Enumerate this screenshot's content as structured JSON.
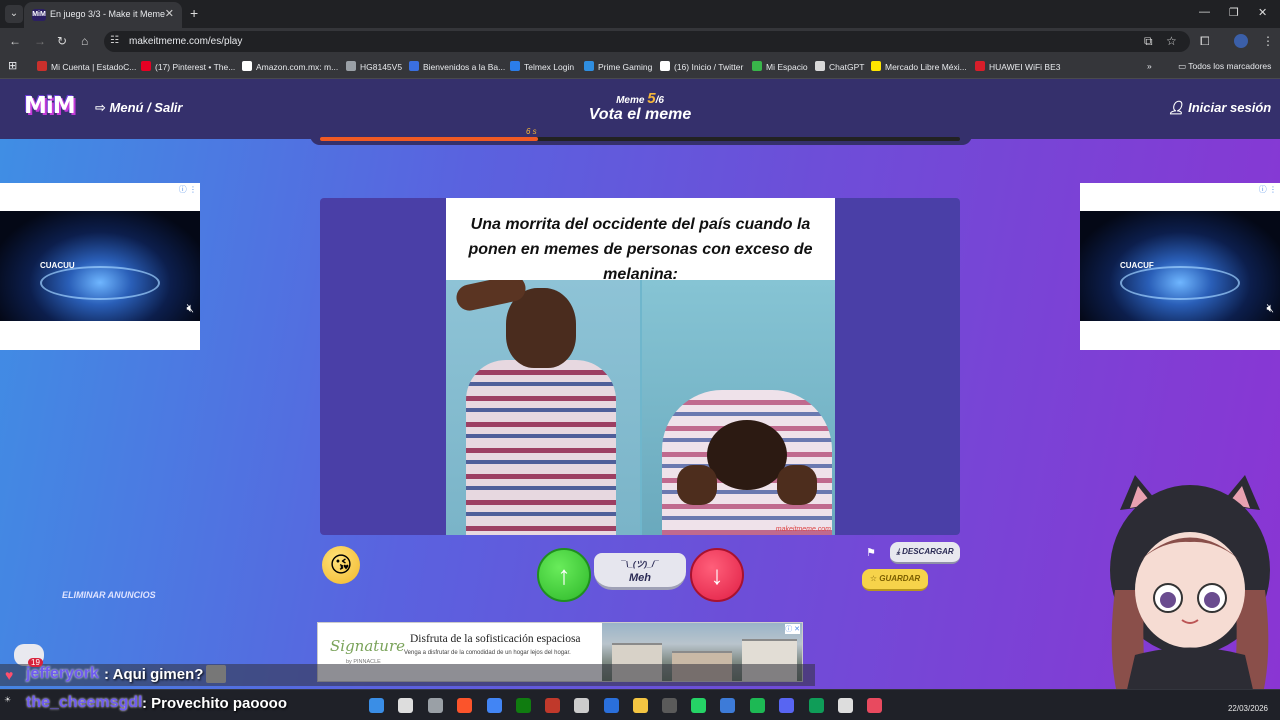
{
  "browser": {
    "tab_title": "En juego 3/3 - Make it Meme",
    "tab_favicon": "MiM",
    "url": "makeitmeme.com/es/play",
    "bookmarks": [
      {
        "label": "Mi Cuenta | EstadoC...",
        "color": "#c9302c"
      },
      {
        "label": "(17) Pinterest • The...",
        "color": "#e60023"
      },
      {
        "label": "Amazon.com.mx: m...",
        "color": "#ffffff"
      },
      {
        "label": "HG8145V5",
        "color": "#9aa0a6"
      },
      {
        "label": "Bienvenidos a la Ba...",
        "color": "#3a6fe0"
      },
      {
        "label": "Telmex Login",
        "color": "#2b7de9"
      },
      {
        "label": "Prime Gaming",
        "color": "#2f8ee0"
      },
      {
        "label": "(16) Inicio / Twitter",
        "color": "#ffffff"
      },
      {
        "label": "Mi Espacio",
        "color": "#39b54a"
      },
      {
        "label": "ChatGPT",
        "color": "#d9d9d9"
      },
      {
        "label": "Mercado Libre Méxi...",
        "color": "#ffe600"
      },
      {
        "label": "HUAWEI WiFi BE3",
        "color": "#d81e2a"
      }
    ],
    "all_bookmarks": "Todos los marcadores"
  },
  "site": {
    "logo": "MiM",
    "menu": "Menú / Salir",
    "meme_label": "Meme",
    "meme_current": "5",
    "meme_total": "/6",
    "vote_title": "Vota el meme",
    "login": "Iniciar sesión",
    "timer_label": "6 s",
    "timer_fraction": 0.34
  },
  "meme": {
    "caption": "Una morrita del occidente del país cuando la ponen en memes de personas con exceso de melanina:",
    "watermark": "makeitmeme.com"
  },
  "actions": {
    "shrug": "¯\\_(ツ)_/¯",
    "meh": "Meh",
    "download": "DESCARGAR",
    "save": "GUARDAR",
    "remove_ads": "ELIMINAR ANUNCIOS"
  },
  "ads": {
    "side_brand": "CUACUU",
    "side_brand_right": "CUACUF",
    "bottom_logo": "Signature",
    "bottom_logo_sub": "by PINNACLE",
    "bottom_title": "Disfruta de la sofisticación espaciosa",
    "bottom_sub": "Venga a disfrutar de la comodidad de un hogar lejos del hogar."
  },
  "chat": [
    {
      "badge": "19",
      "user": "jefferyork",
      "message": ": Aqui gimen?"
    },
    {
      "badge": "",
      "user": "the_cheemsgdl",
      "message": ": Provechito paoooo"
    }
  ],
  "taskbar": {
    "date": "22/03/2026",
    "icon_colors": [
      "#3a8ee6",
      "#dddddd",
      "#9aa0a6",
      "#fb542b",
      "#4285f4",
      "#107c10",
      "#c0392b",
      "#cccccc",
      "#2a6fdb",
      "#f4c542",
      "#5a5a5a",
      "#25d366",
      "#3d7bd8",
      "#1db954",
      "#5865f2",
      "#0f9d58",
      "#dddddd",
      "#e84a5f"
    ]
  }
}
